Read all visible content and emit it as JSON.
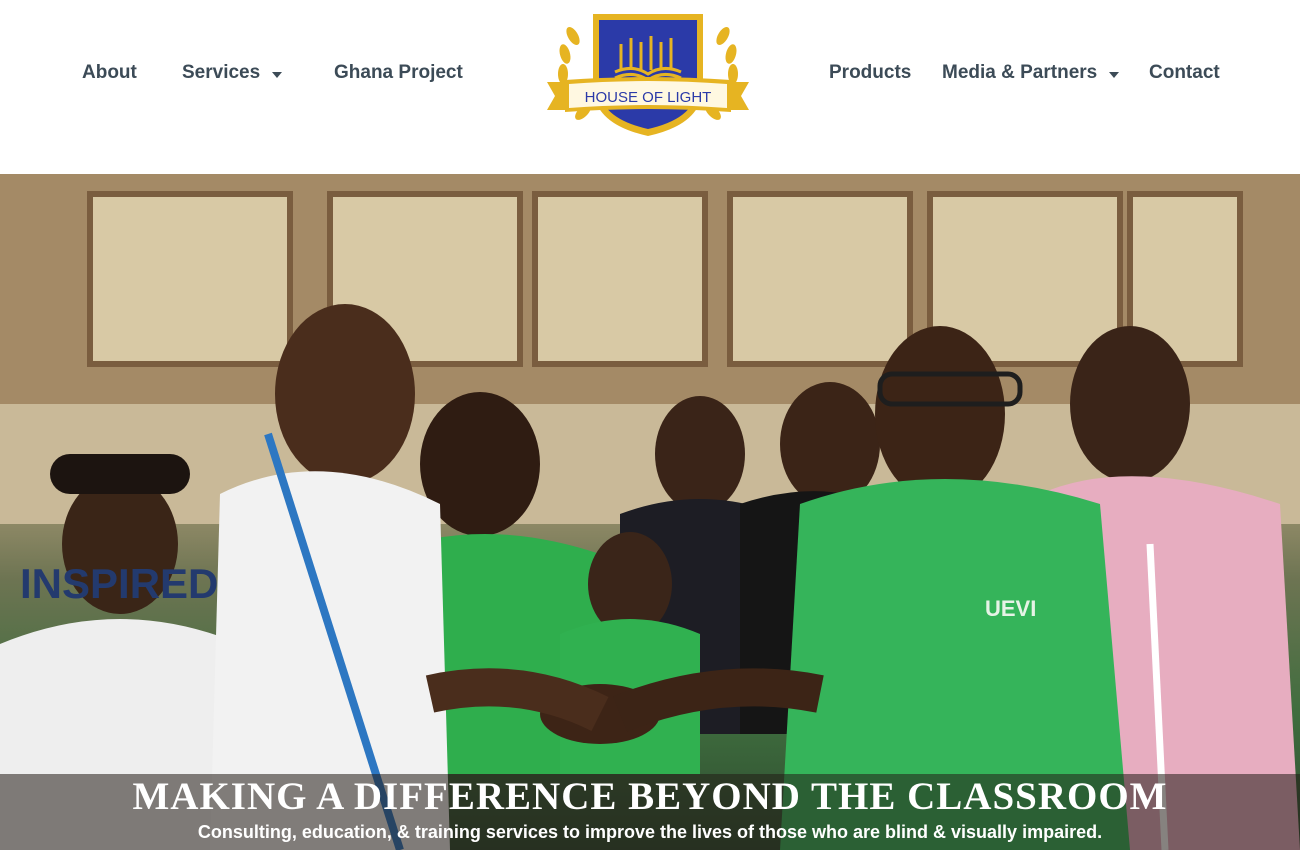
{
  "nav": {
    "left": [
      {
        "label": "About",
        "has_dropdown": false
      },
      {
        "label": "Services",
        "has_dropdown": true
      },
      {
        "label": "Ghana Project",
        "has_dropdown": false
      }
    ],
    "right": [
      {
        "label": "Products",
        "has_dropdown": false
      },
      {
        "label": "Media & Partners",
        "has_dropdown": true
      },
      {
        "label": "Contact",
        "has_dropdown": false
      }
    ],
    "dropdown_icon": "caret-down-icon"
  },
  "logo": {
    "text": "HOUSE OF LIGHT",
    "icon": "books-emblem-icon",
    "colors": {
      "shield": "#2b3aa8",
      "gold": "#e6b422",
      "ribbon": "#fff8e1"
    }
  },
  "hero": {
    "title": "MAKING A DIFFERENCE BEYOND THE CLASSROOM",
    "subtitle": "Consulting, education, & training services to improve the lives of those who are blind & visually impaired.",
    "shirt_text_left": "INSPIRED",
    "shirt_text_right": "UEVI"
  },
  "colors": {
    "nav_text": "#3c4b57",
    "hero_text": "#ffffff"
  }
}
